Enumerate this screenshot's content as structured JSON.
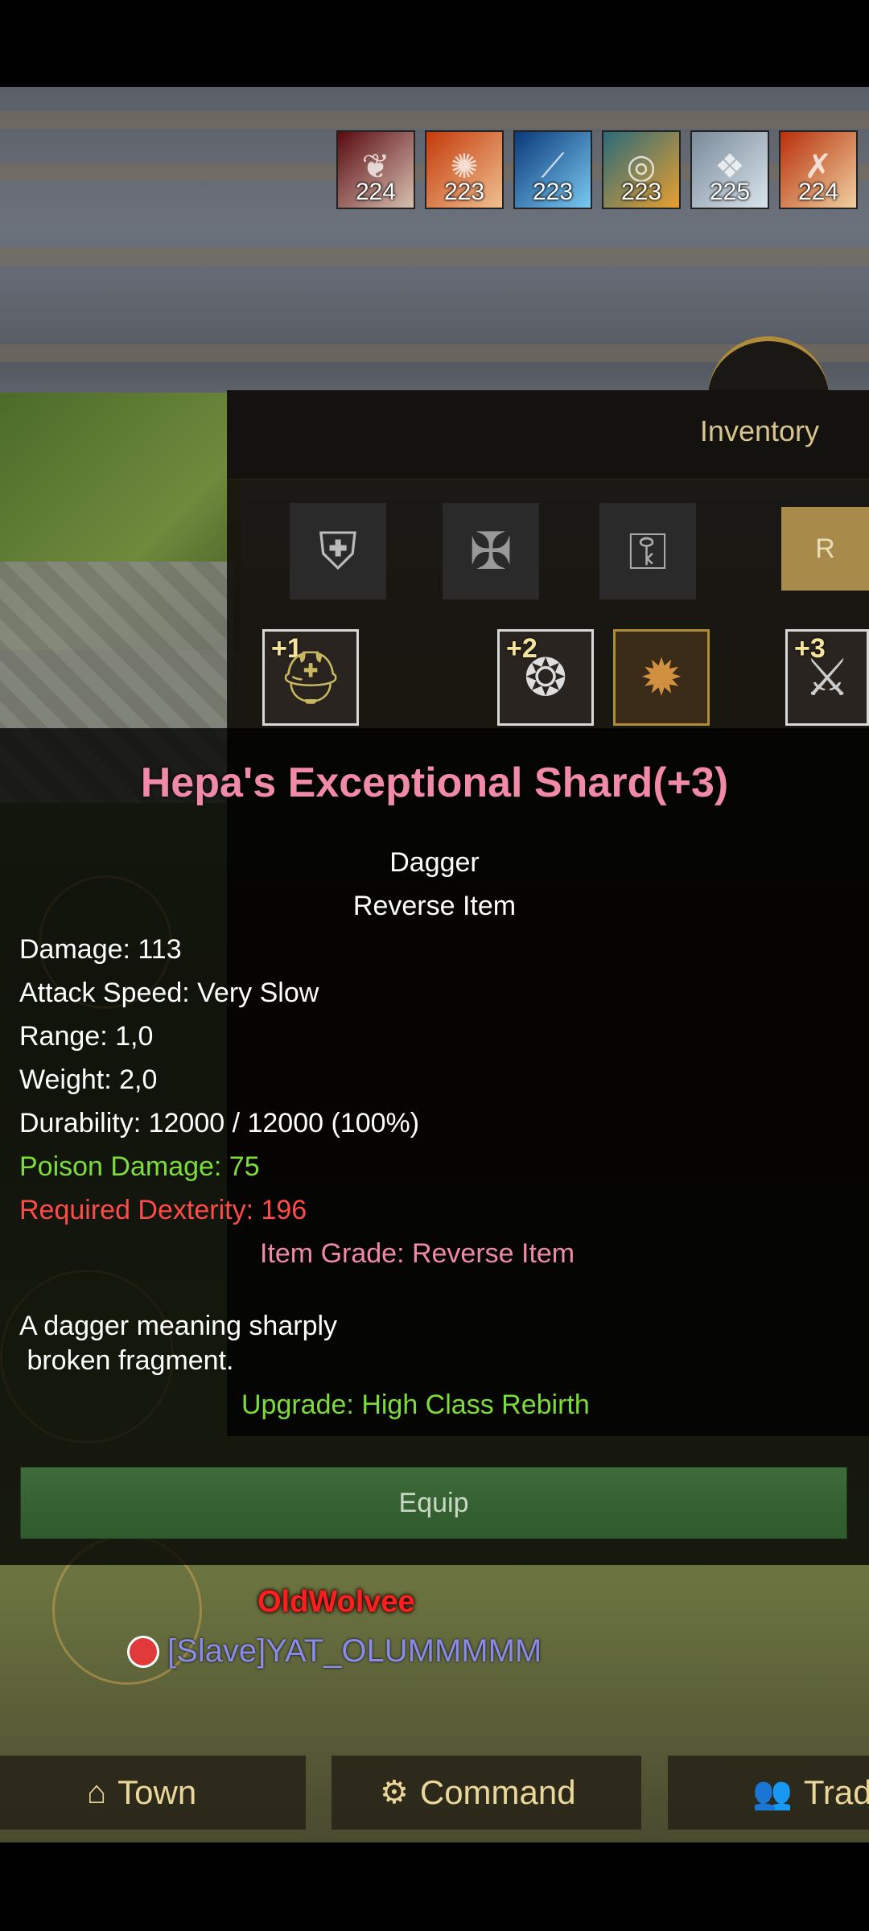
{
  "buffs": [
    {
      "num": "224",
      "glyph": "❦",
      "c1": "#5a0a10",
      "c2": "#d8c0b0"
    },
    {
      "num": "223",
      "glyph": "✺",
      "c1": "#c43a0a",
      "c2": "#f0c090"
    },
    {
      "num": "223",
      "glyph": "⟋",
      "c1": "#0a3a7a",
      "c2": "#7ac8f0"
    },
    {
      "num": "223",
      "glyph": "◎",
      "c1": "#2a6a7a",
      "c2": "#e8a030"
    },
    {
      "num": "225",
      "glyph": "❖",
      "c1": "#7a8a9a",
      "c2": "#d8e4ec"
    },
    {
      "num": "224",
      "glyph": "✗",
      "c1": "#b8300a",
      "c2": "#f0d0a0"
    }
  ],
  "inventory": {
    "title": "Inventory",
    "r_label": "R",
    "equip_slots": [
      {
        "plus": "+1"
      },
      {
        "plus": "+2"
      },
      {
        "plus": ""
      },
      {
        "plus": "+3"
      }
    ]
  },
  "tooltip": {
    "title": "Hepa's Exceptional Shard(+3)",
    "type": "Dagger",
    "subtype": "Reverse Item",
    "damage": "Damage: 113",
    "attack_speed": "Attack Speed: Very Slow",
    "range": "Range: 1,0",
    "weight": "Weight: 2,0",
    "durability": "Durability: 12000 / 12000 (100%)",
    "poison": "Poison Damage: 75",
    "required": "Required Dexterity: 196",
    "grade": "Item Grade: Reverse Item",
    "desc1": "A dagger meaning sharply",
    "desc2": " broken fragment.",
    "upgrade": "Upgrade: High Class Rebirth",
    "equip_label": "Equip"
  },
  "world": {
    "player_name": "OldWolvee",
    "slave_name": "[Slave]YAT_OLUMMMMM"
  },
  "navbar": {
    "town": "Town",
    "command": "Command",
    "trade": "Trad"
  }
}
